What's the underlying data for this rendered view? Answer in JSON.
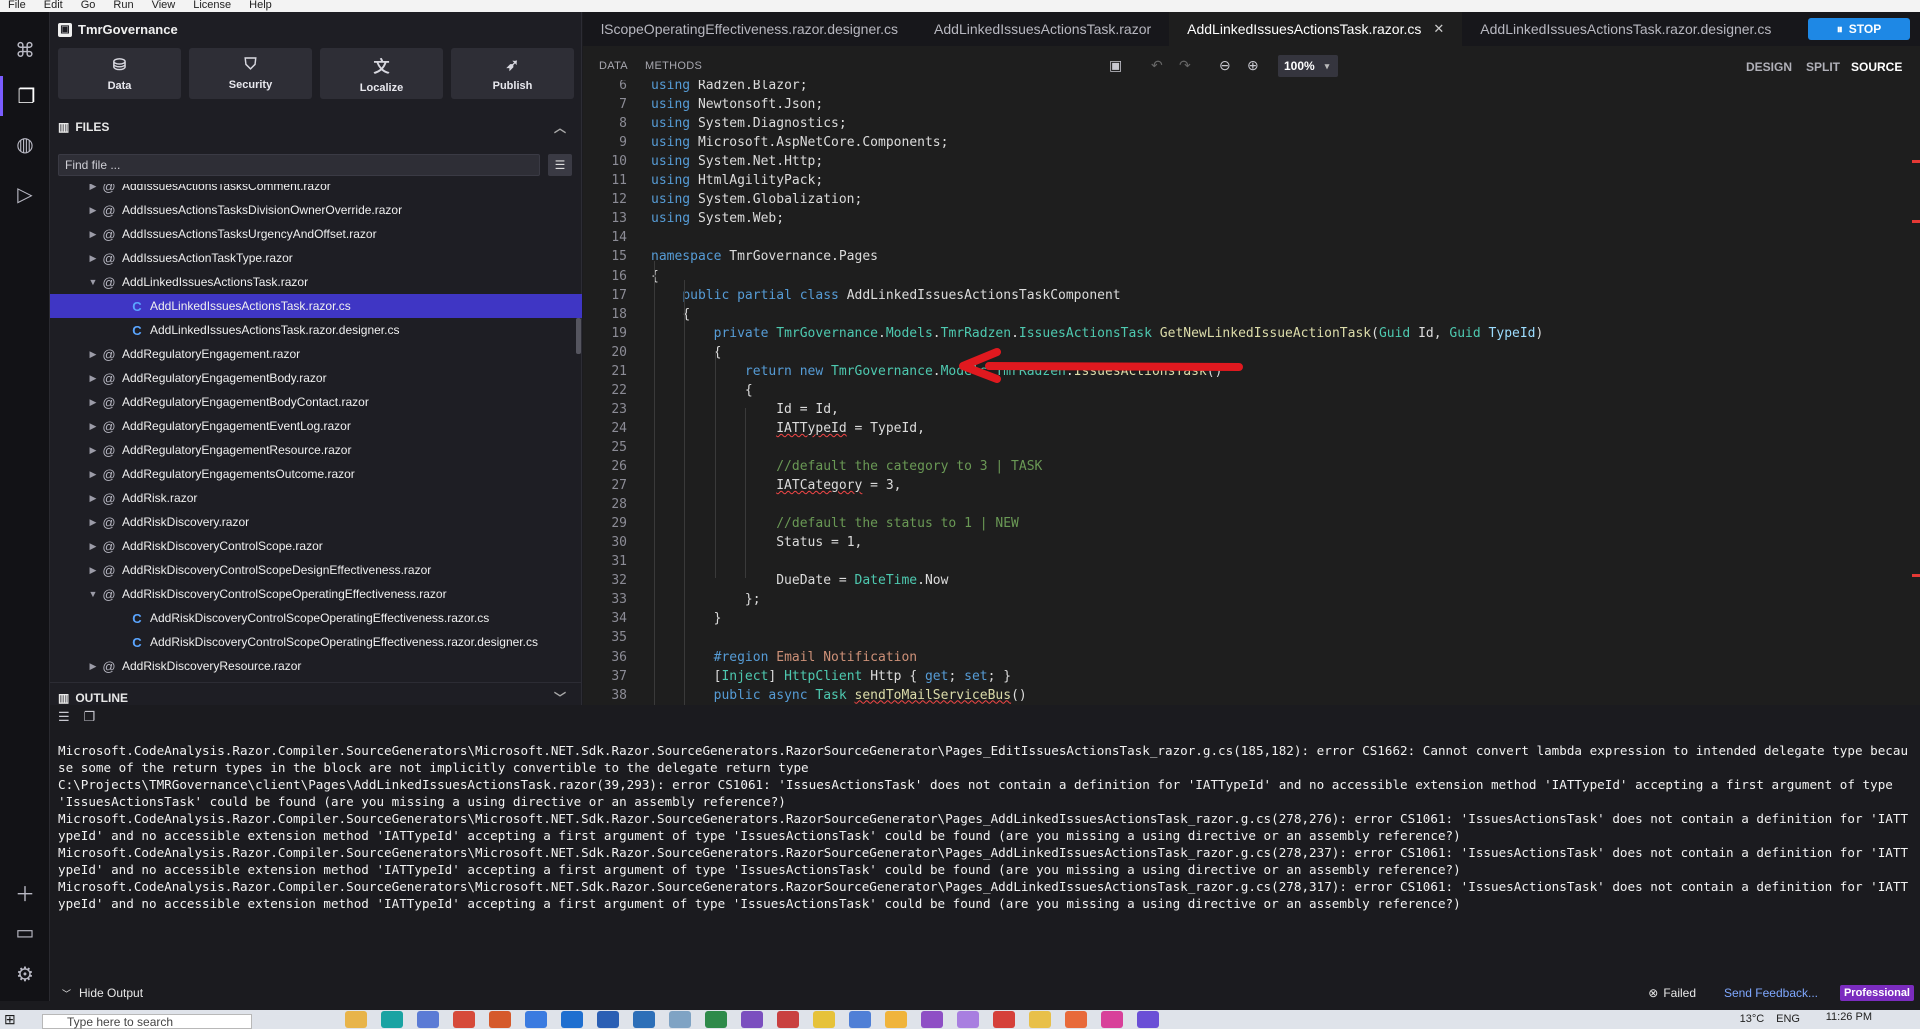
{
  "menubar": [
    "File",
    "Edit",
    "Go",
    "Run",
    "View",
    "License",
    "Help"
  ],
  "activity_icons": [
    "components-icon",
    "files-icon",
    "themes-icon",
    "debug-icon",
    "add-icon",
    "folder-icon",
    "settings-icon"
  ],
  "project": {
    "name": "TmrGovernance"
  },
  "tiles": [
    {
      "label": "Data",
      "icon": "database-icon",
      "glyph": "⛁"
    },
    {
      "label": "Security",
      "icon": "shield-icon",
      "glyph": "⛉"
    },
    {
      "label": "Localize",
      "icon": "translate-icon",
      "glyph": "文"
    },
    {
      "label": "Publish",
      "icon": "rocket-icon",
      "glyph": "➶"
    }
  ],
  "files": {
    "title": "FILES",
    "search_placeholder": "Find file ...",
    "items": [
      {
        "name": "AddIssuesActionsTasksComment.razor",
        "type": "razor",
        "depth": 1,
        "expanded": false,
        "selected": false
      },
      {
        "name": "AddIssuesActionsTasksDivisionOwnerOverride.razor",
        "type": "razor",
        "depth": 1,
        "expanded": false,
        "selected": false
      },
      {
        "name": "AddIssuesActionsTasksUrgencyAndOffset.razor",
        "type": "razor",
        "depth": 1,
        "expanded": false,
        "selected": false
      },
      {
        "name": "AddIssuesActionTaskType.razor",
        "type": "razor",
        "depth": 1,
        "expanded": false,
        "selected": false
      },
      {
        "name": "AddLinkedIssuesActionsTask.razor",
        "type": "razor",
        "depth": 1,
        "expanded": true,
        "selected": false
      },
      {
        "name": "AddLinkedIssuesActionsTask.razor.cs",
        "type": "cs",
        "depth": 2,
        "expanded": false,
        "selected": true
      },
      {
        "name": "AddLinkedIssuesActionsTask.razor.designer.cs",
        "type": "cs",
        "depth": 2,
        "expanded": false,
        "selected": false
      },
      {
        "name": "AddRegulatoryEngagement.razor",
        "type": "razor",
        "depth": 1,
        "expanded": false,
        "selected": false
      },
      {
        "name": "AddRegulatoryEngagementBody.razor",
        "type": "razor",
        "depth": 1,
        "expanded": false,
        "selected": false
      },
      {
        "name": "AddRegulatoryEngagementBodyContact.razor",
        "type": "razor",
        "depth": 1,
        "expanded": false,
        "selected": false
      },
      {
        "name": "AddRegulatoryEngagementEventLog.razor",
        "type": "razor",
        "depth": 1,
        "expanded": false,
        "selected": false
      },
      {
        "name": "AddRegulatoryEngagementResource.razor",
        "type": "razor",
        "depth": 1,
        "expanded": false,
        "selected": false
      },
      {
        "name": "AddRegulatoryEngagementsOutcome.razor",
        "type": "razor",
        "depth": 1,
        "expanded": false,
        "selected": false
      },
      {
        "name": "AddRisk.razor",
        "type": "razor",
        "depth": 1,
        "expanded": false,
        "selected": false
      },
      {
        "name": "AddRiskDiscovery.razor",
        "type": "razor",
        "depth": 1,
        "expanded": false,
        "selected": false
      },
      {
        "name": "AddRiskDiscoveryControlScope.razor",
        "type": "razor",
        "depth": 1,
        "expanded": false,
        "selected": false
      },
      {
        "name": "AddRiskDiscoveryControlScopeDesignEffectiveness.razor",
        "type": "razor",
        "depth": 1,
        "expanded": false,
        "selected": false
      },
      {
        "name": "AddRiskDiscoveryControlScopeOperatingEffectiveness.razor",
        "type": "razor",
        "depth": 1,
        "expanded": true,
        "selected": false
      },
      {
        "name": "AddRiskDiscoveryControlScopeOperatingEffectiveness.razor.cs",
        "type": "cs",
        "depth": 2,
        "expanded": false,
        "selected": false
      },
      {
        "name": "AddRiskDiscoveryControlScopeOperatingEffectiveness.razor.designer.cs",
        "type": "cs",
        "depth": 2,
        "expanded": false,
        "selected": false
      },
      {
        "name": "AddRiskDiscoveryResource.razor",
        "type": "razor",
        "depth": 1,
        "expanded": false,
        "selected": false
      }
    ]
  },
  "outline": {
    "title": "OUTLINE"
  },
  "tabs": [
    {
      "label": "lScopeOperatingEffectiveness.razor.designer.cs",
      "active": false
    },
    {
      "label": "AddLinkedIssuesActionsTask.razor",
      "active": false
    },
    {
      "label": "AddLinkedIssuesActionsTask.razor.cs",
      "active": true
    },
    {
      "label": "AddLinkedIssuesActionsTask.razor.designer.cs",
      "active": false
    }
  ],
  "stop_label": "STOP",
  "toolbar": {
    "data": "DATA",
    "methods": "METHODS",
    "zoom": "100%",
    "design": "DESIGN",
    "split": "SPLIT",
    "source": "SOURCE"
  },
  "code": [
    {
      "n": "6",
      "t": "using Radzen.Blazor;"
    },
    {
      "n": "7",
      "t": "using Newtonsoft.Json;"
    },
    {
      "n": "8",
      "t": "using System.Diagnostics;"
    },
    {
      "n": "9",
      "t": "using Microsoft.AspNetCore.Components;"
    },
    {
      "n": "10",
      "t": "using System.Net.Http;"
    },
    {
      "n": "11",
      "t": "using HtmlAgilityPack;"
    },
    {
      "n": "12",
      "t": "using System.Globalization;"
    },
    {
      "n": "13",
      "t": "using System.Web;"
    },
    {
      "n": "14",
      "t": ""
    },
    {
      "n": "15",
      "t": "namespace TmrGovernance.Pages"
    },
    {
      "n": "16",
      "t": "{"
    },
    {
      "n": "17",
      "t": "    public partial class AddLinkedIssuesActionsTaskComponent"
    },
    {
      "n": "18",
      "t": "    {"
    },
    {
      "n": "19",
      "t": "        private TmrGovernance.Models.TmrRadzen.IssuesActionsTask GetNewLinkedIssueActionTask(Guid Id, Guid TypeId)"
    },
    {
      "n": "20",
      "t": "        {"
    },
    {
      "n": "21",
      "t": "            return new TmrGovernance.Models.TmrRadzen.IssuesActionsTask()"
    },
    {
      "n": "22",
      "t": "            {"
    },
    {
      "n": "23",
      "t": "                Id = Id,"
    },
    {
      "n": "24",
      "t": "                IATTypeId = TypeId,"
    },
    {
      "n": "25",
      "t": ""
    },
    {
      "n": "26",
      "t": "                //default the category to 3 | TASK"
    },
    {
      "n": "27",
      "t": "                IATCategory = 3,"
    },
    {
      "n": "28",
      "t": ""
    },
    {
      "n": "29",
      "t": "                //default the status to 1 | NEW"
    },
    {
      "n": "30",
      "t": "                Status = 1,"
    },
    {
      "n": "31",
      "t": ""
    },
    {
      "n": "32",
      "t": "                DueDate = DateTime.Now"
    },
    {
      "n": "33",
      "t": "            };"
    },
    {
      "n": "34",
      "t": "        }"
    },
    {
      "n": "35",
      "t": ""
    },
    {
      "n": "36",
      "t": "        #region Email Notification"
    },
    {
      "n": "37",
      "t": "        [Inject] HttpClient Http { get; set; }"
    },
    {
      "n": "38",
      "t": "        public async Task sendToMailServiceBus()"
    }
  ],
  "output": [
    "Microsoft.CodeAnalysis.Razor.Compiler.SourceGenerators\\Microsoft.NET.Sdk.Razor.SourceGenerators.RazorSourceGenerator\\Pages_EditIssuesActionsTask_razor.g.cs(185,182): error CS1662: Cannot convert lambda expression to intended delegate type because some of the return types in the block are not implicitly convertible to the delegate return type",
    "C:\\Projects\\TMRGovernance\\client\\Pages\\AddLinkedIssuesActionsTask.razor(39,293): error CS1061: 'IssuesActionsTask' does not contain a definition for 'IATTypeId' and no accessible extension method 'IATTypeId' accepting a first argument of type 'IssuesActionsTask' could be found (are you missing a using directive or an assembly reference?)",
    "Microsoft.CodeAnalysis.Razor.Compiler.SourceGenerators\\Microsoft.NET.Sdk.Razor.SourceGenerators.RazorSourceGenerator\\Pages_AddLinkedIssuesActionsTask_razor.g.cs(278,276): error CS1061: 'IssuesActionsTask' does not contain a definition for 'IATTypeId' and no accessible extension method 'IATTypeId' accepting a first argument of type 'IssuesActionsTask' could be found (are you missing a using directive or an assembly reference?)",
    "Microsoft.CodeAnalysis.Razor.Compiler.SourceGenerators\\Microsoft.NET.Sdk.Razor.SourceGenerators.RazorSourceGenerator\\Pages_AddLinkedIssuesActionsTask_razor.g.cs(278,237): error CS1061: 'IssuesActionsTask' does not contain a definition for 'IATTypeId' and no accessible extension method 'IATTypeId' accepting a first argument of type 'IssuesActionsTask' could be found (are you missing a using directive or an assembly reference?)",
    "Microsoft.CodeAnalysis.Razor.Compiler.SourceGenerators\\Microsoft.NET.Sdk.Razor.SourceGenerators.RazorSourceGenerator\\Pages_AddLinkedIssuesActionsTask_razor.g.cs(278,317): error CS1061: 'IssuesActionsTask' does not contain a definition for 'IATTypeId' and no accessible extension method 'IATTypeId' accepting a first argument of type 'IssuesActionsTask' could be found (are you missing a using directive or an assembly reference?)"
  ],
  "status": {
    "hide_output": "Hide Output",
    "failed": "Failed",
    "feedback": "Send Feedback...",
    "plan": "Professional"
  },
  "taskbar": {
    "search_placeholder": "Type here to search",
    "temperature": "13°C",
    "language": "ENG",
    "time": "11:26 PM"
  }
}
